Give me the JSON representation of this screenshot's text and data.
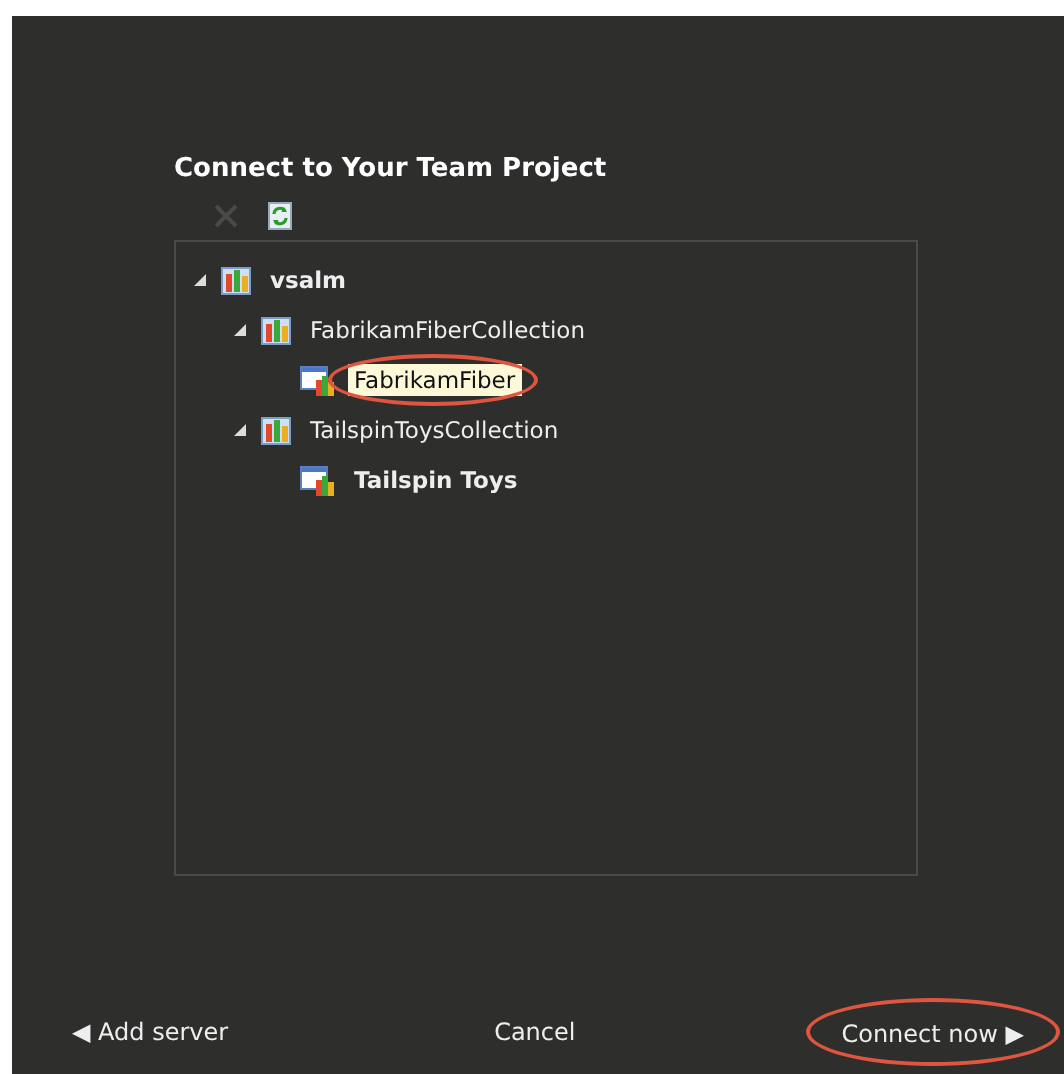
{
  "dialog": {
    "title": "Connect to Your Team Project"
  },
  "toolbar": [
    {
      "kind": "remove",
      "disabled": true
    },
    {
      "kind": "refresh",
      "disabled": false
    }
  ],
  "tree": [
    {
      "label": "vsalm",
      "kind": "server",
      "bold": true,
      "expanded": true,
      "selected": false,
      "circled": false,
      "children": [
        {
          "label": "FabrikamFiberCollection",
          "kind": "collection",
          "bold": false,
          "expanded": true,
          "selected": false,
          "circled": false,
          "children": [
            {
              "label": "FabrikamFiber",
              "kind": "project",
              "bold": false,
              "selected": true,
              "circled": true
            }
          ]
        },
        {
          "label": "TailspinToysCollection",
          "kind": "collection",
          "bold": false,
          "expanded": true,
          "selected": false,
          "circled": false,
          "children": [
            {
              "label": "Tailspin Toys",
              "kind": "project",
              "bold": true,
              "selected": false,
              "circled": false
            }
          ]
        }
      ]
    }
  ],
  "footer": {
    "back": {
      "arrow": "◀",
      "label": "Add server"
    },
    "cancel": {
      "label": "Cancel"
    },
    "next": {
      "label": "Connect now",
      "arrow": "▶",
      "circled": true
    }
  }
}
